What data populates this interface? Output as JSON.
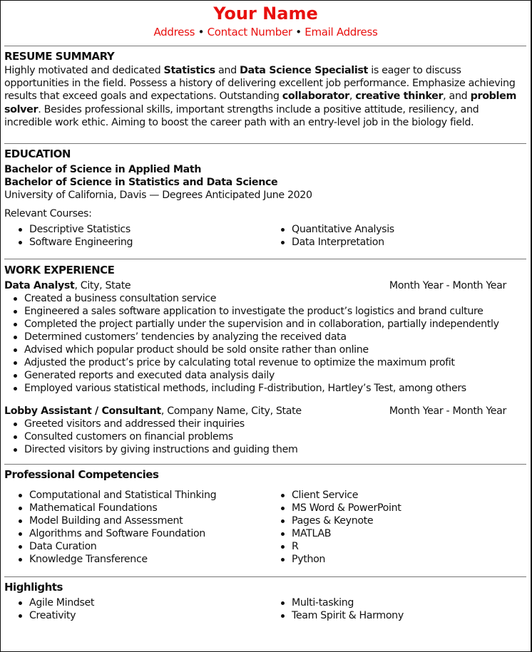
{
  "header": {
    "name": "Your Name",
    "address": "Address",
    "contact_number": "Contact Number",
    "email": "Email Address",
    "separator": "•",
    "accent_color": "#e8100f"
  },
  "summary": {
    "title": "RESUME SUMMARY",
    "segments": [
      {
        "text": "Highly motivated and dedicated ",
        "bold": false
      },
      {
        "text": "Statistics",
        "bold": true
      },
      {
        "text": " and ",
        "bold": false
      },
      {
        "text": "Data Science Specialist",
        "bold": true
      },
      {
        "text": " is eager to discuss opportunities in the field. Possess a history of delivering excellent job performance. Emphasize achieving results that exceed goals and expectations. Outstanding ",
        "bold": false
      },
      {
        "text": "collaborator",
        "bold": true
      },
      {
        "text": ", ",
        "bold": false
      },
      {
        "text": "creative thinker",
        "bold": true
      },
      {
        "text": ", and ",
        "bold": false
      },
      {
        "text": "problem solver",
        "bold": true
      },
      {
        "text": ". Besides professional skills, important strengths include a positive attitude, resiliency, and incredible work ethic. Aiming to boost the career path with an entry-level job in the biology field.",
        "bold": false
      }
    ]
  },
  "education": {
    "title": "EDUCATION",
    "degree1": "Bachelor of Science in Applied Math",
    "degree2": "Bachelor of Science in Statistics and Data Science",
    "school_line": "University of California, Davis — Degrees Anticipated June 2020",
    "courses_label": "Relevant Courses:",
    "courses_left": [
      "Descriptive Statistics",
      "Software Engineering"
    ],
    "courses_right": [
      "Quantitative Analysis",
      "Data Interpretation"
    ]
  },
  "work": {
    "title": "WORK EXPERIENCE",
    "jobs": [
      {
        "role": "Data Analyst",
        "location": ", City, State",
        "dates": "Month Year - Month Year",
        "bullets": [
          "Created a business consultation service",
          "Engineered a sales software application to investigate the product’s logistics and brand culture",
          "Completed the project partially under the supervision and in collaboration, partially independently",
          "Determined customers’ tendencies by analyzing the received data",
          "Advised which popular product should be sold onsite rather than online",
          "Adjusted the product’s price by calculating total revenue to optimize the maximum profit",
          "Generated reports and executed data analysis daily",
          "Employed various statistical methods, including F-distribution, Hartley’s Test, among others"
        ]
      },
      {
        "role": "Lobby Assistant / Consultant",
        "location": ", Company Name, City, State",
        "dates": "Month Year - Month Year",
        "bullets": [
          "Greeted visitors and addressed their inquiries",
          "Consulted customers on financial problems",
          "Directed visitors by giving instructions and guiding them"
        ]
      }
    ]
  },
  "competencies": {
    "title": "Professional Competencies",
    "left": [
      "Computational and Statistical Thinking",
      "Mathematical Foundations",
      "Model Building and Assessment",
      "Algorithms and Software Foundation",
      "Data Curation",
      "Knowledge Transference"
    ],
    "right": [
      "Client Service",
      "MS Word & PowerPoint",
      "Pages & Keynote",
      "MATLAB",
      "R",
      "Python"
    ]
  },
  "highlights": {
    "title": "Highlights",
    "left": [
      "Agile Mindset",
      "Creativity"
    ],
    "right": [
      "Multi-tasking",
      "Team Spirit & Harmony"
    ]
  }
}
